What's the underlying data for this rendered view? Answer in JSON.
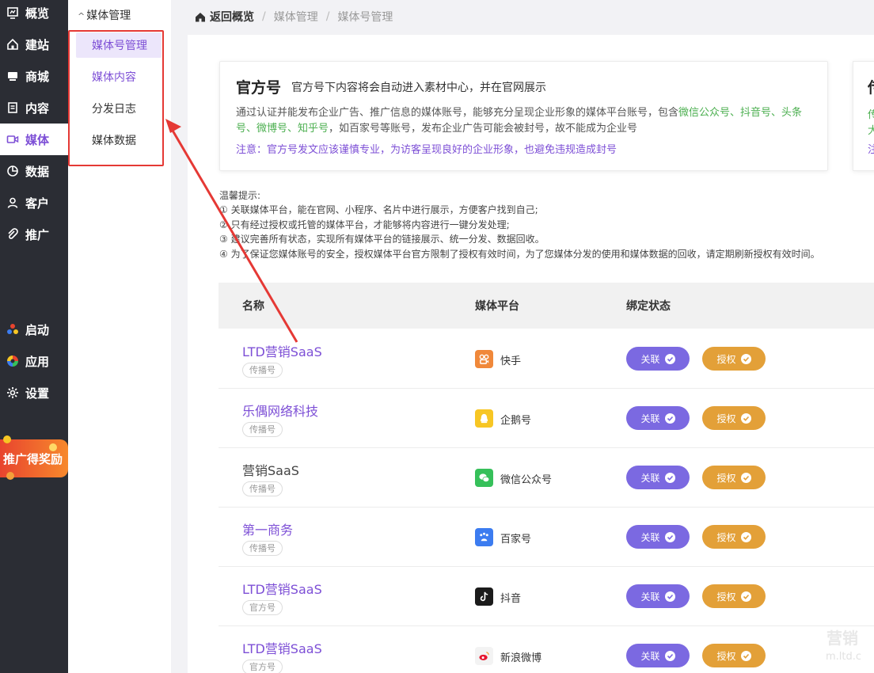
{
  "nav": {
    "items": [
      {
        "label": "概览",
        "icon": "overview-icon"
      },
      {
        "label": "建站",
        "icon": "home-icon"
      },
      {
        "label": "商城",
        "icon": "shop-icon"
      },
      {
        "label": "内容",
        "icon": "document-icon"
      },
      {
        "label": "媒体",
        "icon": "media-icon",
        "active": true
      },
      {
        "label": "数据",
        "icon": "pie-chart-icon"
      },
      {
        "label": "客户",
        "icon": "user-icon"
      },
      {
        "label": "推广",
        "icon": "paperclip-icon"
      },
      {
        "label": "启动",
        "icon": "launch-icon"
      },
      {
        "label": "应用",
        "icon": "apps-icon"
      },
      {
        "label": "设置",
        "icon": "gear-icon"
      }
    ],
    "promo": "推广得奖励"
  },
  "submenu": {
    "title": "媒体管理",
    "items": [
      "媒体号管理",
      "媒体内容",
      "分发日志",
      "媒体数据"
    ]
  },
  "breadcrumb": {
    "home": "返回概览",
    "level1": "媒体管理",
    "level2": "媒体号管理"
  },
  "official": {
    "title": "官方号",
    "subtitle": "官方号下内容将会自动进入素材中心，并在官网展示",
    "desc_before": "通过认证并能发布企业广告、推广信息的媒体账号，能够充分呈现企业形象的媒体平台账号，包含",
    "desc_platforms": "微信公众号、抖音号、头条号、微博号、知乎号",
    "desc_after": "，如百家号等账号，发布企业广告可能会被封号，故不能成为企业号",
    "note": "注意：官方号发文应该谨慎专业，为访客呈现良好的企业形象，也避免违规造成封号"
  },
  "side_card": {
    "line1": "传",
    "line2": "传",
    "line3": "大",
    "line4": "注"
  },
  "tips": {
    "title": "温馨提示:",
    "lines": [
      "① 关联媒体平台，能在官网、小程序、名片中进行展示，方便客户找到自己;",
      "② 只有经过授权或托管的媒体平台，才能够将内容进行一键分发处理;",
      "③ 建议完善所有状态，实现所有媒体平台的链接展示、统一分发、数据回收。",
      "④ 为了保证您媒体账号的安全，授权媒体平台官方限制了授权有效时间，为了您媒体分发的使用和媒体数据的回收，请定期刷新授权有效时间。"
    ]
  },
  "table": {
    "headers": {
      "name": "名称",
      "platform": "媒体平台",
      "status": "绑定状态"
    },
    "link_label": "关联",
    "auth_label": "授权",
    "rows": [
      {
        "name": "LTD营销SaaS",
        "tag": "传播号",
        "platform": "快手",
        "icon": "kuaishou-icon",
        "color": "#f0883a"
      },
      {
        "name": "乐偶网络科技",
        "tag": "传播号",
        "platform": "企鹅号",
        "icon": "penguin-icon",
        "color": "#f7c624"
      },
      {
        "name": "营销SaaS",
        "tag": "传播号",
        "platform": "微信公众号",
        "icon": "wechat-icon",
        "color": "#36c05a"
      },
      {
        "name": "第一商务",
        "tag": "传播号",
        "platform": "百家号",
        "icon": "baijia-icon",
        "color": "#3c7cf0"
      },
      {
        "name": "LTD营销SaaS",
        "tag": "官方号",
        "platform": "抖音",
        "icon": "douyin-icon",
        "color": "#1b1b1b"
      },
      {
        "name": "LTD营销SaaS",
        "tag": "官方号",
        "platform": "新浪微博",
        "icon": "weibo-icon",
        "color": "#f3f3f3"
      }
    ]
  },
  "watermark": {
    "line1": "营销",
    "line2": "m.ltd.c"
  },
  "accent": "#7d4fd6",
  "annotation_color": "#e53935"
}
